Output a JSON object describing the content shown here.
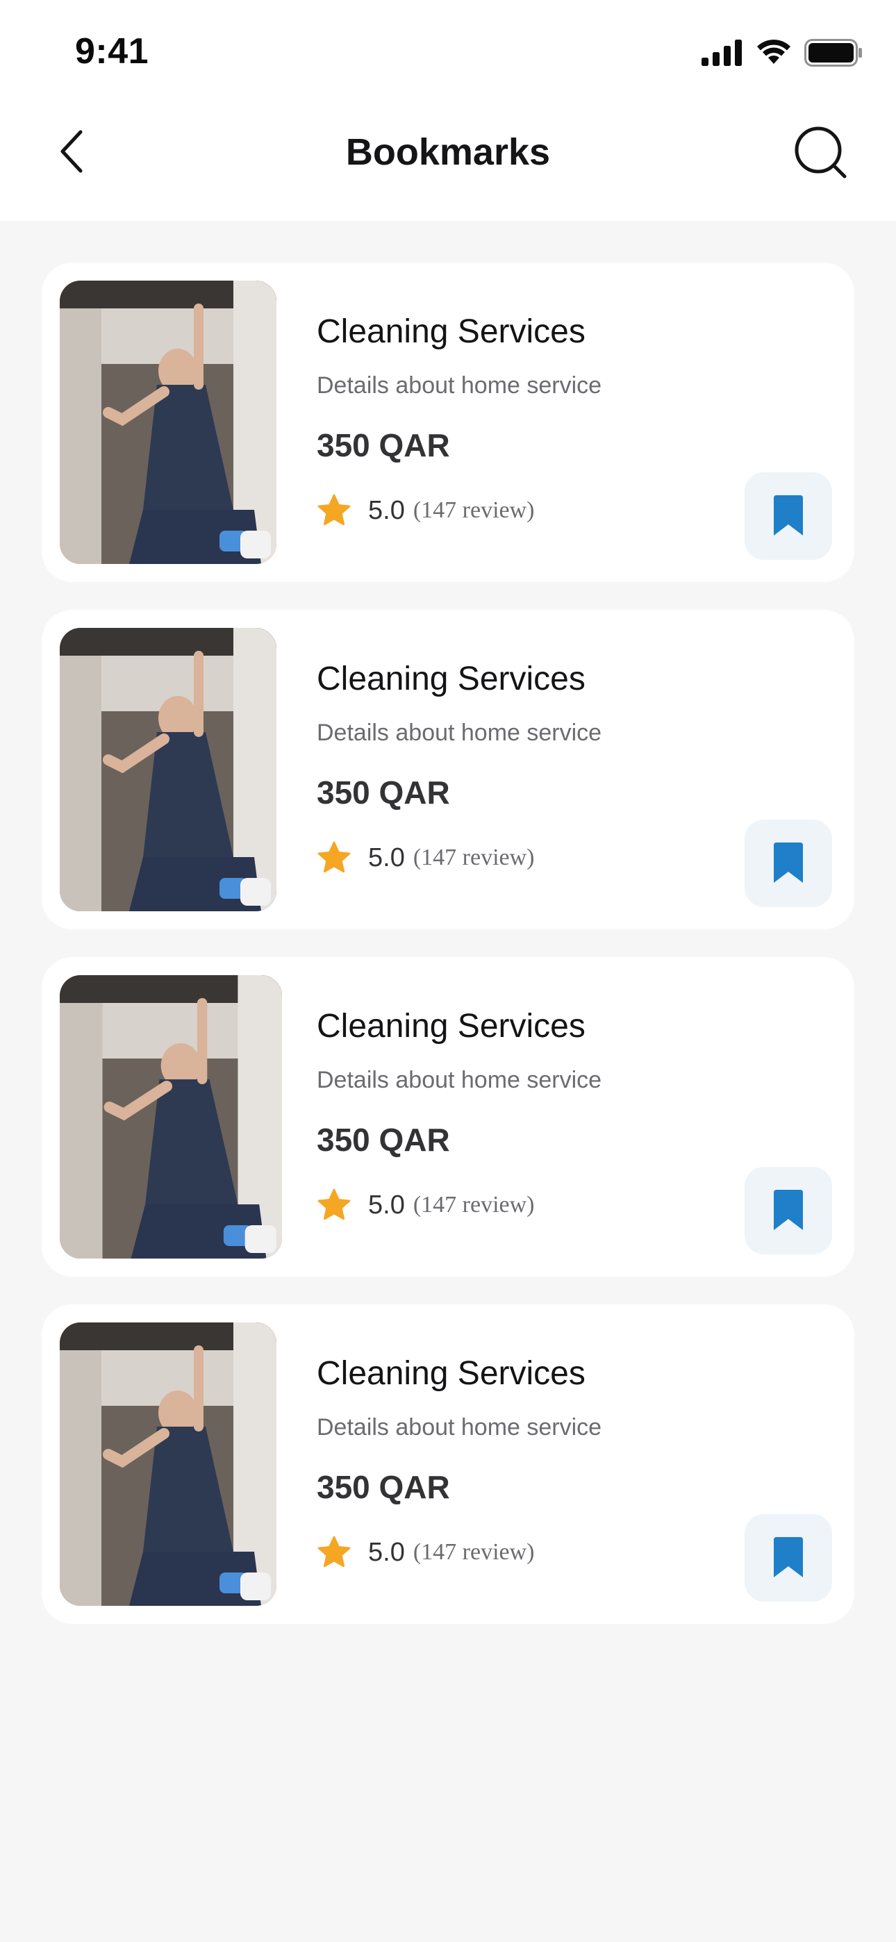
{
  "status_bar": {
    "time": "9:41"
  },
  "header": {
    "title": "Bookmarks",
    "back_icon": "chevron-left-icon",
    "search_icon": "search-icon"
  },
  "colors": {
    "accent": "#1f7fc8",
    "star": "#f5a623",
    "bookmark_bg": "#eef4f8",
    "page_bg": "#f6f6f7"
  },
  "bookmarks": [
    {
      "title": "Cleaning Services",
      "description": "Details about home service",
      "price": "350 QAR",
      "rating": "5.0",
      "reviews": "(147 review)"
    },
    {
      "title": "Cleaning Services",
      "description": "Details about home service",
      "price": "350 QAR",
      "rating": "5.0",
      "reviews": "(147 review)"
    },
    {
      "title": "Cleaning Services",
      "description": "Details about home service",
      "price": "350 QAR",
      "rating": "5.0",
      "reviews": "(147 review)"
    },
    {
      "title": "Cleaning Services",
      "description": "Details about home service",
      "price": "350 QAR",
      "rating": "5.0",
      "reviews": "(147 review)"
    }
  ]
}
